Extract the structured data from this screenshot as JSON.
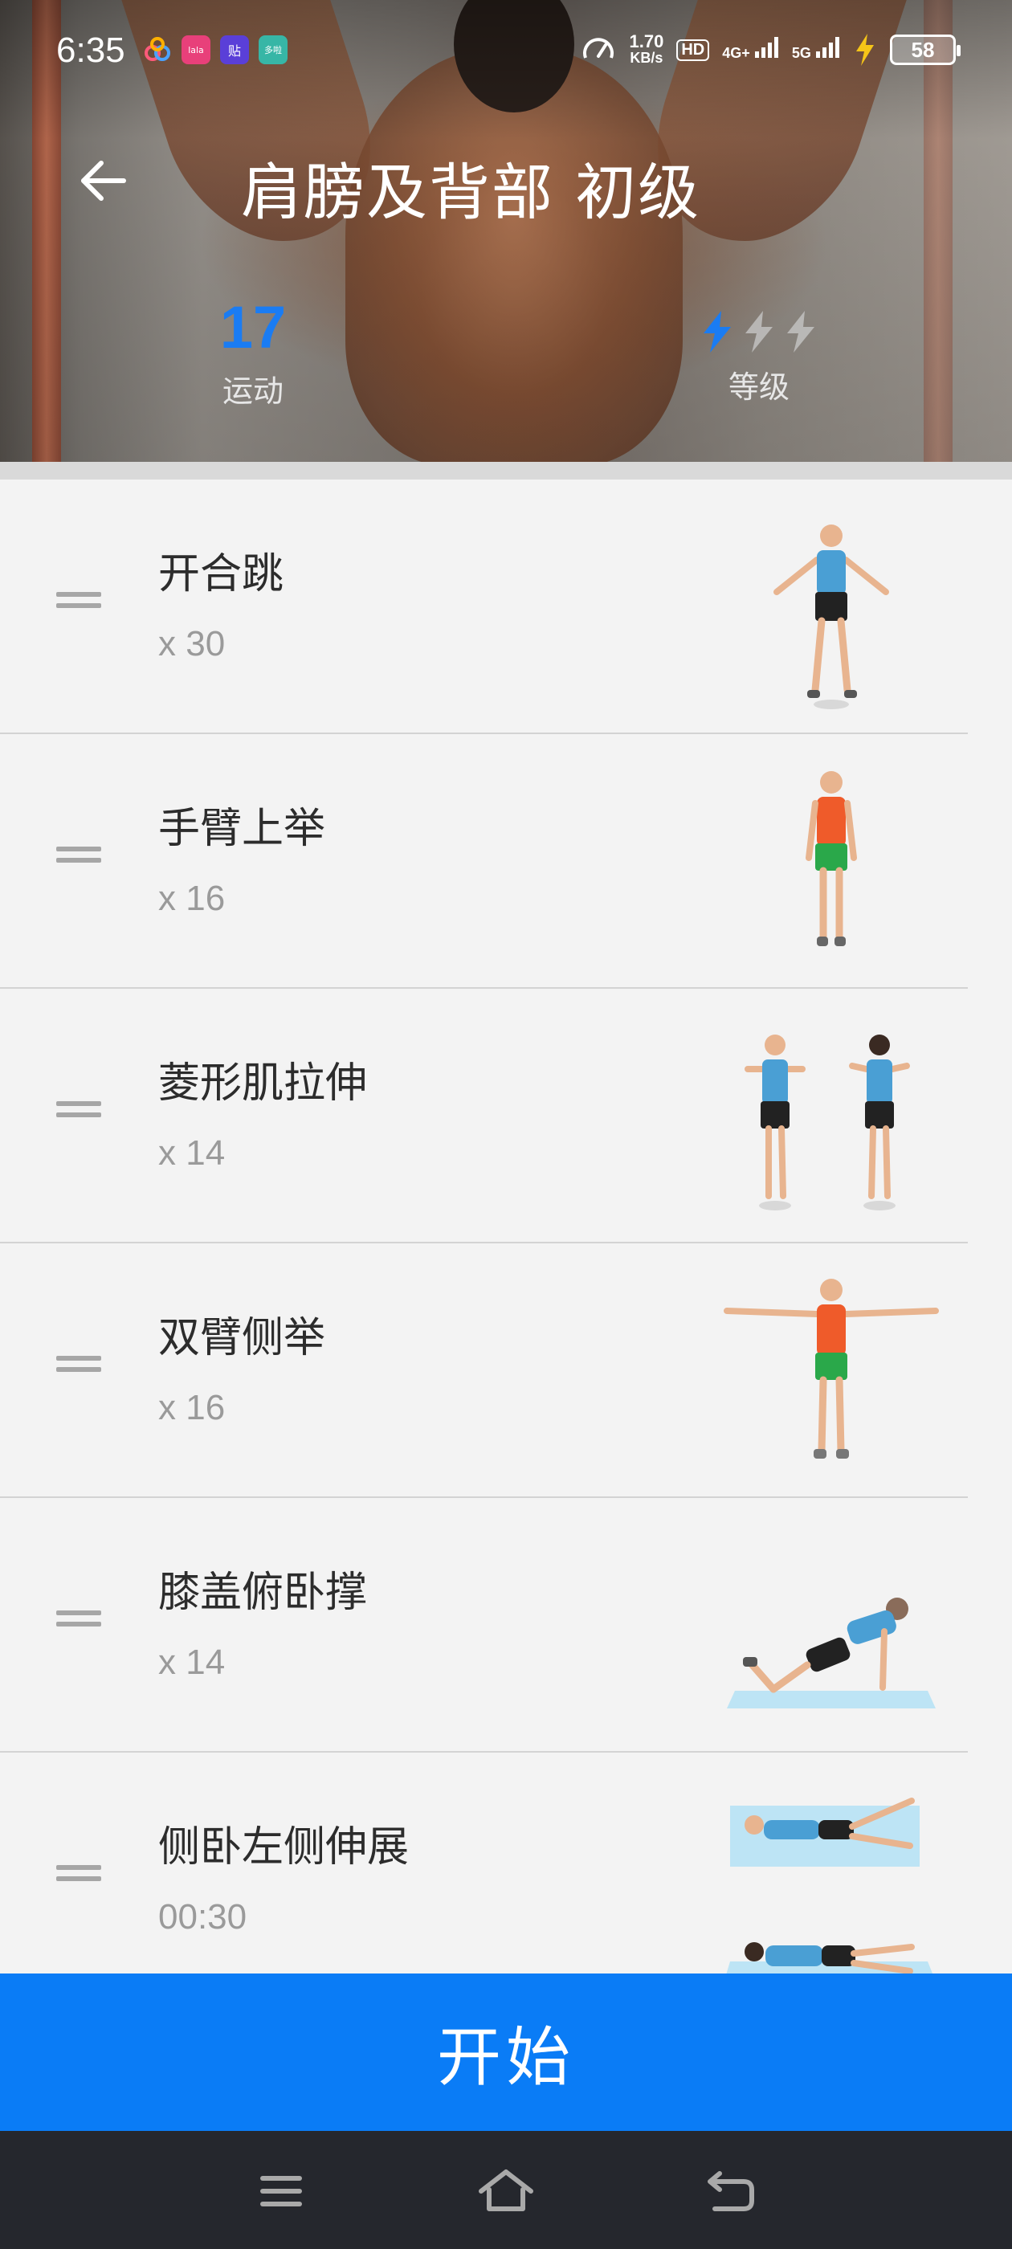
{
  "status_bar": {
    "time": "6:35",
    "speed_value": "1.70",
    "speed_unit": "KB/s",
    "hd_label": "HD",
    "net_4g": "4G+",
    "net_5g": "5G",
    "battery": "58",
    "app_icons": [
      "app-icon-1",
      "app-icon-2",
      "app-icon-3",
      "app-icon-4"
    ],
    "app_icon_texts": [
      "",
      "lala",
      "贴",
      "多啦"
    ]
  },
  "header": {
    "title": "肩膀及背部 初级",
    "exercise_count": "17",
    "exercise_count_label": "运动",
    "level_label": "等级",
    "level_active": 1,
    "level_total": 3
  },
  "exercises": [
    {
      "name": "开合跳",
      "reps": "x 30",
      "illustration": "jumping-jacks-figure"
    },
    {
      "name": "手臂上举",
      "reps": "x 16",
      "illustration": "arm-raise-figure"
    },
    {
      "name": "菱形肌拉伸",
      "reps": "x 14",
      "illustration": "rhomboid-stretch-figure"
    },
    {
      "name": "双臂侧举",
      "reps": "x 16",
      "illustration": "side-arm-raise-figure"
    },
    {
      "name": "膝盖俯卧撑",
      "reps": "x 14",
      "illustration": "knee-pushup-figure"
    },
    {
      "name": "侧卧左侧伸展",
      "reps": "00:30",
      "illustration": "side-lying-stretch-figure"
    }
  ],
  "start_button": {
    "label": "开始"
  },
  "colors": {
    "accent": "#0a7cf6",
    "count_blue": "#1a7cf3",
    "nav_bar": "#25272d",
    "list_bg": "#f3f3f3"
  },
  "nav": {
    "icons": [
      "menu-icon",
      "home-icon",
      "back-icon"
    ]
  }
}
